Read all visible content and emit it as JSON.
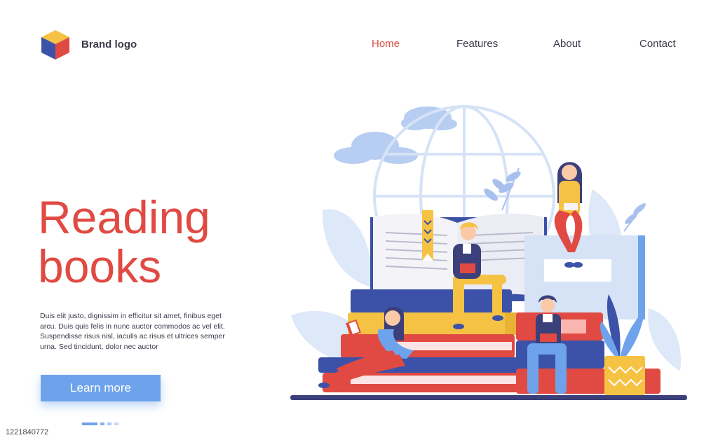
{
  "brand": {
    "logo_text": "Brand logo",
    "logo_colors": {
      "top": "#f6c244",
      "left": "#3b52a8",
      "right": "#e04a42"
    }
  },
  "nav": {
    "items": [
      {
        "label": "Home",
        "active": true
      },
      {
        "label": "Features",
        "active": false
      },
      {
        "label": "About",
        "active": false
      },
      {
        "label": "Contact",
        "active": false
      }
    ]
  },
  "hero": {
    "title_line1": "Reading",
    "title_line2": "books",
    "body": "Duis elit justo, dignissim in efficitur sit amet, finibus eget arcu. Duis quis felis in nunc auctor commodos ac vel elit. Suspendisse risus nisl, iaculis ac risus et ultrices semper urna. Sed tincidunt, dolor nec auctor",
    "cta_label": "Learn more"
  },
  "pager": {
    "count": 4,
    "active_index": 0
  },
  "stock_id": "1221840772",
  "colors": {
    "accent": "#e04a42",
    "button": "#6ea3ec",
    "text": "#3a3a4a",
    "navy": "#3b52a8",
    "yellow": "#f6c244"
  }
}
